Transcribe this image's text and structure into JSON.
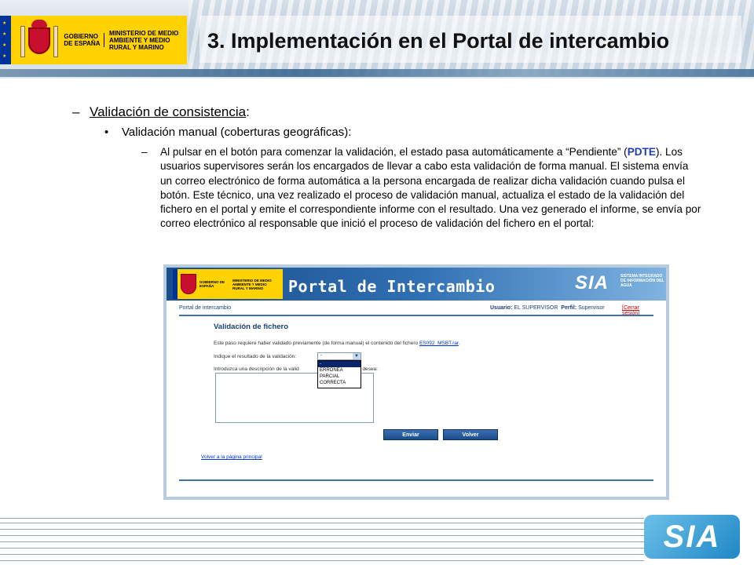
{
  "header": {
    "gov_line1": "GOBIERNO DE ESPAÑA",
    "gov_line2": "MINISTERIO DE MEDIO AMBIENTE Y MEDIO RURAL Y MARINO",
    "title": "3. Implementación en el Portal de intercambio"
  },
  "content": {
    "level1_dash": "–",
    "level1_underlined": "Validación de consistencia",
    "level1_suffix": ":",
    "level2_bullet": "•",
    "level2_text": "Validación manual (coberturas geográficas):",
    "level3_dash": "–",
    "level3_part1": "Al pulsar en el botón para comenzar la validación, el estado pasa automáticamente a “Pendiente” (",
    "level3_highlight": "PDTE",
    "level3_part2": "). Los usuarios supervisores serán los encargados de llevar a cabo esta validación de forma manual. El sistema envía un correo electrónico de forma automática a la persona encargada de realizar dicha validación cuando pulsa el botón. Este técnico, una vez realizado el proceso de validación manual, actualiza el estado de la validación del fichero en el portal y emite el correspondiente informe con el resultado. Una vez generado el informe, se envía por correo electrónico al responsable que inició el proceso de validación del fichero en el portal:"
  },
  "portal": {
    "gov_line1": "GOBIERNO DE ESPAÑA",
    "gov_line2": "MINISTERIO DE MEDIO AMBIENTE Y MEDIO RURAL Y MARINO",
    "banner_title": "Portal de Intercambio",
    "sia_logo": "SIA",
    "sia_subtitle": "SISTEMA INTEGRADO DE INFORMACIÓN DEL AGUA",
    "breadcrumb": "Portal de intercambio",
    "user_label": "Usuario:",
    "user_value": "EL SUPERVISOR",
    "profile_label": "Perfil:",
    "profile_value": "Supervisor",
    "logout": "[Cerrar sesión]",
    "section_title": "Validación de fichero",
    "intro_text": "Este paso requiere haber validado previamente (de forma manual) el contenido del fichero ",
    "file_link": "ES092_MSBT.rar",
    "intro_end": ".",
    "result_label": "Indique el resultado de la validación:",
    "select_value": "-",
    "select_options": [
      "-",
      "ERRÓNEA",
      "PARCIAL",
      "CORRECTA"
    ],
    "description_label_start": "Introduzca una descripción de la valid",
    "description_label_end": "s, etc), si lo desea:",
    "send_button": "Enviar",
    "back_button": "Volver",
    "home_link": "Volver a la página principal"
  },
  "footer": {
    "sia_logo": "SIA"
  }
}
